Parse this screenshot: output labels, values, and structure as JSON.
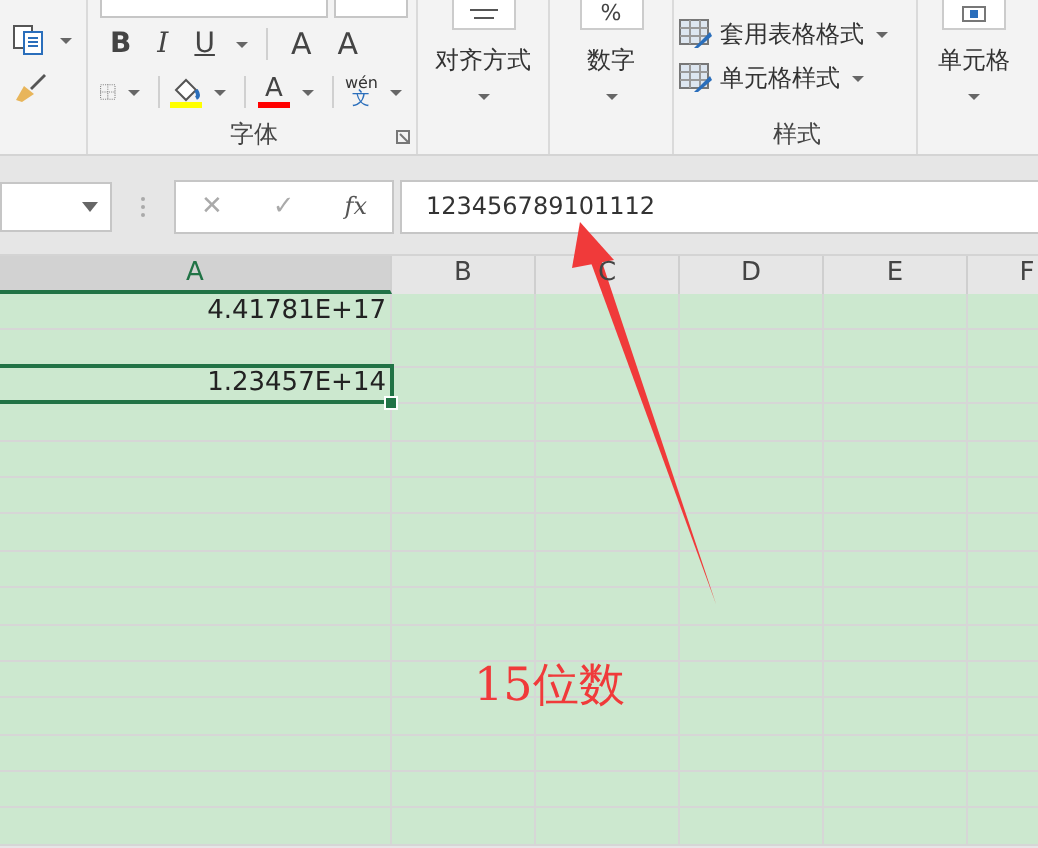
{
  "ribbon": {
    "font_group": {
      "label": "字体",
      "bold": "B",
      "italic": "I",
      "underline": "U",
      "grow": "A",
      "shrink": "A",
      "font_color_letter": "A",
      "phonetic_top": "wén",
      "phonetic_bottom": "文"
    },
    "alignment": {
      "label": "对齐方式"
    },
    "number": {
      "symbol": "%",
      "label": "数字"
    },
    "styles": {
      "items": [
        "套用表格格式",
        "单元格样式"
      ],
      "label": "样式"
    },
    "cells": {
      "label": "单元格"
    }
  },
  "formula_bar": {
    "cancel": "✕",
    "enter": "✓",
    "fx": "fx",
    "value": "123456789101112"
  },
  "columns": [
    {
      "label": "A",
      "selected": true
    },
    {
      "label": "B",
      "selected": false
    },
    {
      "label": "C",
      "selected": false
    },
    {
      "label": "D",
      "selected": false
    },
    {
      "label": "E",
      "selected": false
    },
    {
      "label": "F",
      "selected": false
    }
  ],
  "rows": [
    {
      "value": "4.41781E+17",
      "selected": false
    },
    {
      "selected": false
    },
    {
      "value": "1.23457E+14",
      "selected": true
    },
    {
      "selected": false
    },
    {
      "selected": false
    },
    {
      "selected": false
    },
    {
      "selected": false
    },
    {
      "selected": false
    },
    {
      "selected": false
    },
    {
      "selected": false
    },
    {
      "selected": false
    },
    {
      "selected": false
    },
    {
      "selected": false
    },
    {
      "selected": false
    },
    {
      "selected": false
    }
  ],
  "annotation": {
    "text": "15位数"
  }
}
